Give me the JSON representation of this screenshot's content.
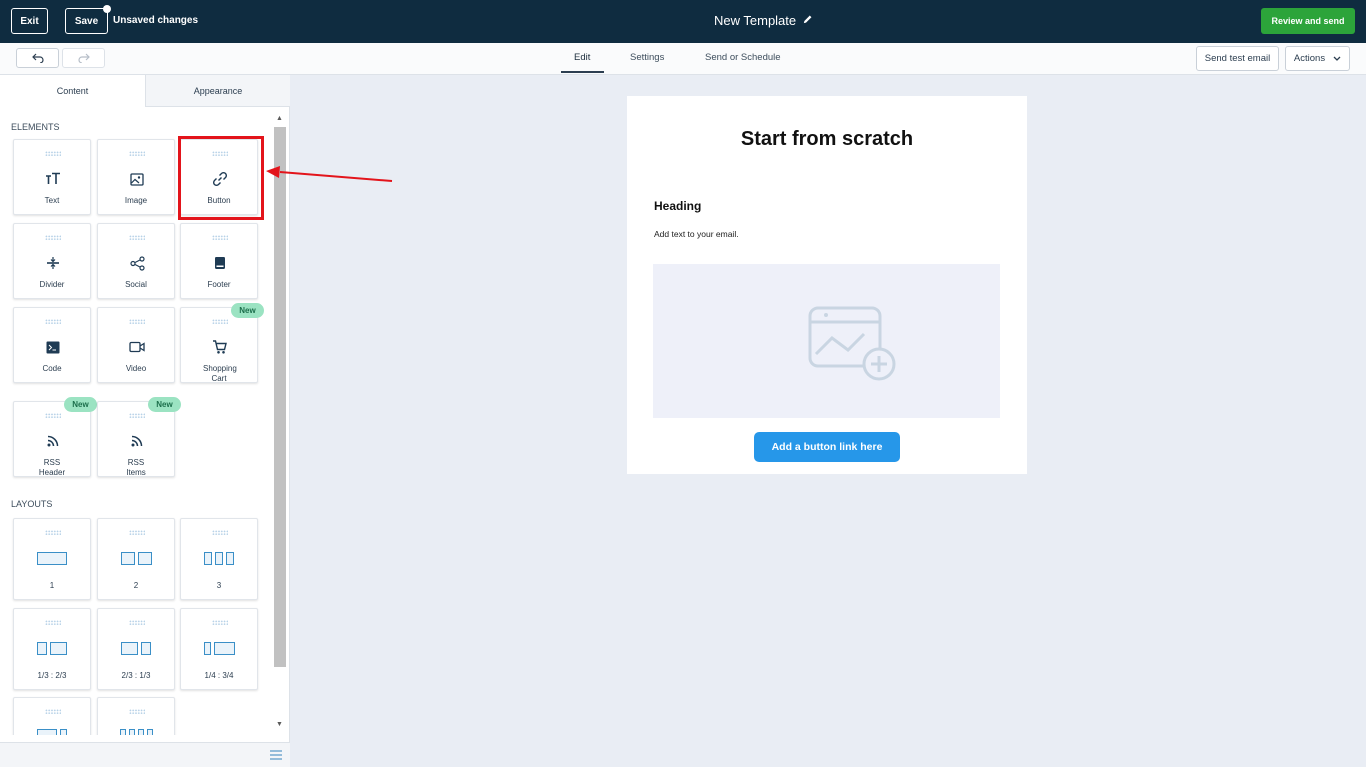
{
  "topbar": {
    "exit_label": "Exit",
    "save_label": "Save",
    "unsaved_text": "Unsaved changes",
    "template_title": "New Template",
    "review_label": "Review and send"
  },
  "subbar": {
    "tabs": [
      "Edit",
      "Settings",
      "Send or Schedule"
    ],
    "send_test_label": "Send test email",
    "actions_label": "Actions"
  },
  "sidebar": {
    "tabs": [
      "Content",
      "Appearance"
    ],
    "elements_title": "ELEMENTS",
    "elements": [
      {
        "label": "Text",
        "icon": "text-icon"
      },
      {
        "label": "Image",
        "icon": "image-icon"
      },
      {
        "label": "Button",
        "icon": "link-icon"
      },
      {
        "label": "Divider",
        "icon": "divider-icon"
      },
      {
        "label": "Social",
        "icon": "share-icon"
      },
      {
        "label": "Footer",
        "icon": "footer-icon"
      },
      {
        "label": "Code",
        "icon": "terminal-icon"
      },
      {
        "label": "Video",
        "icon": "video-icon"
      },
      {
        "label": "Shopping Cart",
        "icon": "cart-icon",
        "badge": "New"
      },
      {
        "label": "RSS Header",
        "icon": "rss-icon",
        "badge": "New"
      },
      {
        "label": "RSS Items",
        "icon": "rss-icon",
        "badge": "New"
      }
    ],
    "layouts_title": "LAYOUTS",
    "layouts": [
      {
        "label": "1"
      },
      {
        "label": "2"
      },
      {
        "label": "3"
      },
      {
        "label": "1/3 : 2/3"
      },
      {
        "label": "2/3 : 1/3"
      },
      {
        "label": "1/4 : 3/4"
      },
      {
        "label": ""
      },
      {
        "label": ""
      }
    ]
  },
  "email": {
    "title": "Start from scratch",
    "heading": "Heading",
    "body_text": "Add text to your email.",
    "button_text": "Add a button link here"
  },
  "colors": {
    "topbar_bg": "#0f2c40",
    "review_green": "#2ca43a",
    "canvas_bg": "#e9edf4",
    "email_button_blue": "#2697e9",
    "highlight_red": "#e3141b",
    "new_badge_green": "#9be3c2"
  }
}
